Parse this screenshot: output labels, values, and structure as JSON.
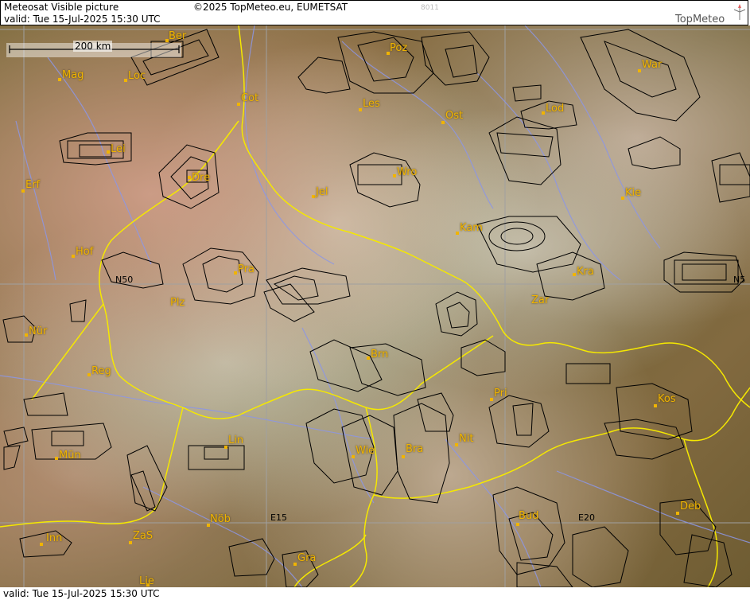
{
  "header": {
    "title": "Meteosat Visible picture",
    "copyright": "©2025 TopMeteo.eu, EUMETSAT",
    "code": "8011",
    "valid": "valid:  Tue  15-Jul-2025  15:30 UTC",
    "logo_text": "TopMeteo"
  },
  "scale": {
    "label": "200 km"
  },
  "footer": {
    "valid": "valid:  Tue  15-Jul-2025  15:30 UTC"
  },
  "grid_labels": {
    "n50_left": "N50",
    "n50_right": "N5",
    "e15": "E15",
    "e20": "E20"
  },
  "cities": {
    "ber": "Ber",
    "mag": "Mag",
    "loc": "Loc",
    "cot": "Cot",
    "poz": "Poz",
    "war": "War",
    "les": "Les",
    "ost": "Ost",
    "lod": "Lod",
    "lei": "Lei",
    "erf": "Erf",
    "dre": "Dre",
    "wro": "Wro",
    "jel": "Jel",
    "kie": "Kie",
    "kam": "Kam",
    "hof": "Hof",
    "pra": "Pra",
    "kra": "Kra",
    "plz": "Plz",
    "zar": "Zar",
    "nur": "Nür",
    "brn": "Brn",
    "reg": "Reg",
    "pri": "Pri",
    "kos": "Kos",
    "lin": "Lin",
    "wie": "Wie",
    "bra": "Bra",
    "nit": "Nit",
    "mun": "Mün",
    "nob": "Nöb",
    "bud": "Bud",
    "deb": "Deb",
    "inn": "Inn",
    "zas": "ZaS",
    "gra": "Gra",
    "lie": "Lie"
  },
  "colors": {
    "city": "#f0b400",
    "border": "#f5e800",
    "river": "#8c96e6",
    "grid": "#a0a0a0",
    "airspace": "#000000",
    "logo_accent": "#e06060"
  }
}
